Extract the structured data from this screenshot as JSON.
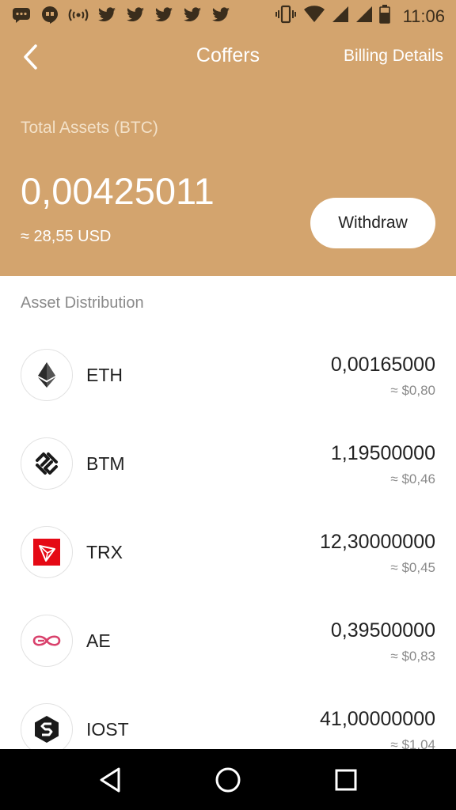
{
  "status_bar": {
    "time": "11:06",
    "left_icons": [
      "chat-icon",
      "hangouts-icon",
      "wifi-calling-icon",
      "twitter-icon",
      "twitter-icon",
      "twitter-icon",
      "twitter-icon",
      "twitter-icon"
    ],
    "right_icons": [
      "vibrate-icon",
      "wifi-icon",
      "signal-icon",
      "signal-icon",
      "battery-icon"
    ]
  },
  "nav": {
    "title": "Coffers",
    "billing_label": "Billing Details"
  },
  "summary": {
    "total_label": "Total Assets (BTC)",
    "total_value": "0,00425011",
    "total_usd": "≈ 28,55 USD",
    "withdraw_label": "Withdraw"
  },
  "distribution_label": "Asset Distribution",
  "assets": [
    {
      "name": "ETH",
      "amount": "0,00165000",
      "usd": "≈ $0,80",
      "icon": "eth-icon"
    },
    {
      "name": "BTM",
      "amount": "1,19500000",
      "usd": "≈ $0,46",
      "icon": "btm-icon"
    },
    {
      "name": "TRX",
      "amount": "12,30000000",
      "usd": "≈ $0,45",
      "icon": "trx-icon"
    },
    {
      "name": "AE",
      "amount": "0,39500000",
      "usd": "≈ $0,83",
      "icon": "ae-icon"
    },
    {
      "name": "IOST",
      "amount": "41,00000000",
      "usd": "≈ $1,04",
      "icon": "iost-icon"
    }
  ],
  "colors": {
    "header_bg": "#d3a46e",
    "trx_red": "#e50915",
    "ae_pink": "#d9416c"
  }
}
